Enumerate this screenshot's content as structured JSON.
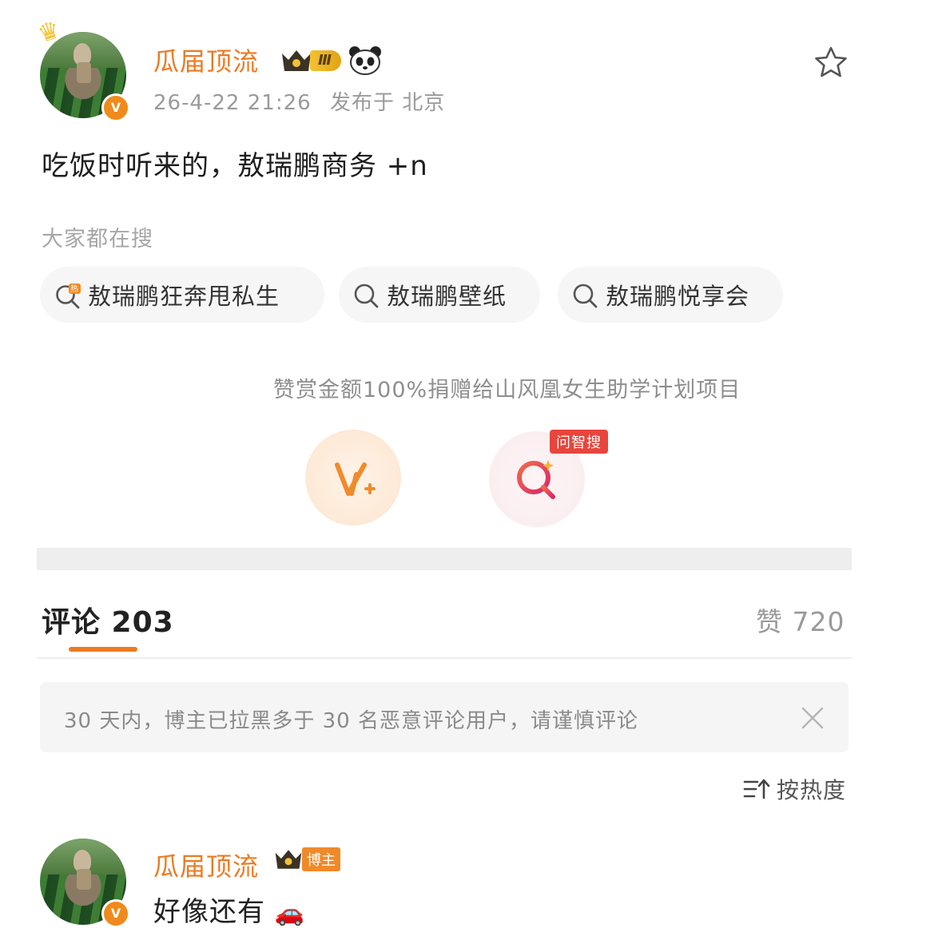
{
  "post": {
    "author": "瓜届顶流",
    "level_badge": "Ⅲ",
    "timestamp": "26-4-22 21:26",
    "location": "发布于 北京",
    "text": "吃饭时听来的，敖瑞鹏商务 +n"
  },
  "search": {
    "label": "大家都在搜",
    "chips": [
      {
        "text": "敖瑞鹏狂奔甩私生",
        "icon": "hot-search-icon"
      },
      {
        "text": "敖瑞鹏壁纸",
        "icon": "search-icon"
      },
      {
        "text": "敖瑞鹏悦享会",
        "icon": "search-icon"
      }
    ]
  },
  "donate": {
    "note": "赞赏金额100%捐赠给山风凰女生助学计划项目",
    "ask_tag": "问智搜"
  },
  "comments_header": {
    "title": "评论 203",
    "likes": "赞 720"
  },
  "notice": {
    "text": "30 天内，博主已拉黑多于 30 名恶意评论用户，请谨慎评论"
  },
  "sort": {
    "label": "按热度"
  },
  "comment": {
    "author": "瓜届顶流",
    "host_tag": "博主",
    "text": "好像还有",
    "emoji": "🚗"
  },
  "colors": {
    "accent": "#ec7a22",
    "brand_red": "#e8453c"
  }
}
